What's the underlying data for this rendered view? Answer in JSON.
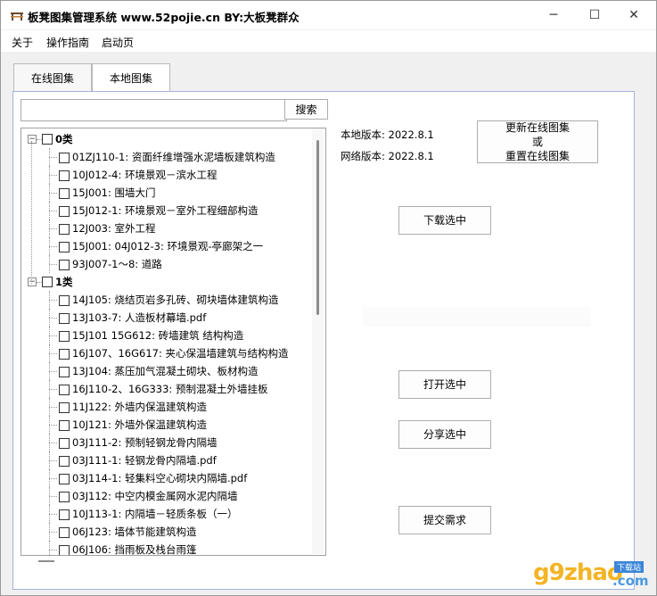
{
  "window": {
    "title": "板凳图集管理系统 www.52pojie.cn  BY:大板凳群众",
    "minimize": "─",
    "maximize": "☐",
    "close": "✕"
  },
  "menu": [
    "关于",
    "操作指南",
    "启动页"
  ],
  "tabs": [
    "在线图集",
    "本地图集"
  ],
  "search": {
    "value": "",
    "button": "搜索"
  },
  "tree": [
    {
      "label": "0类",
      "group": true
    },
    {
      "label": "01ZJ110-1: 资面纤维增强水泥墙板建筑构造"
    },
    {
      "label": "10J012-4: 环境景观－滨水工程"
    },
    {
      "label": "15J001: 围墙大门"
    },
    {
      "label": "15J012-1: 环境景观－室外工程细部构造"
    },
    {
      "label": "12J003: 室外工程"
    },
    {
      "label": "15J001: 04J012-3: 环境景观-亭廊架之一"
    },
    {
      "label": "93J007-1～8: 道路"
    },
    {
      "label": "1类",
      "group": true
    },
    {
      "label": "14J105: 烧结页岩多孔砖、砌块墙体建筑构造"
    },
    {
      "label": "13J103-7: 人造板材幕墙.pdf"
    },
    {
      "label": "15J101 15G612: 砖墙建筑 结构构造"
    },
    {
      "label": "16J107、16G617: 夹心保温墙建筑与结构构造"
    },
    {
      "label": "13J104: 蒸压加气混凝土砌块、板材构造"
    },
    {
      "label": "16J110-2、16G333: 预制混凝土外墙挂板"
    },
    {
      "label": "11J122: 外墙内保温建筑构造"
    },
    {
      "label": "10J121: 外墙外保温建筑构造"
    },
    {
      "label": "03J111-2: 预制轻钢龙骨内隔墙"
    },
    {
      "label": "03J111-1: 轻钢龙骨内隔墙.pdf"
    },
    {
      "label": "03J114-1: 轻集料空心砌块内隔墙.pdf"
    },
    {
      "label": "03J112: 中空内模金属网水泥内隔墙"
    },
    {
      "label": "10J113-1: 内隔墙－轻质条板（一）"
    },
    {
      "label": "06J123: 墙体节能建筑构造"
    },
    {
      "label": "06J106: 挡雨板及栈台雨篷"
    }
  ],
  "info": {
    "local_version": "本地版本: 2022.8.1",
    "net_version": "网络版本: 2022.8.1"
  },
  "buttons": {
    "update_line1": "更新在线图集",
    "update_line2": "或",
    "update_line3": "重置在线图集",
    "download": "下载选中",
    "open": "打开选中",
    "share": "分享选中",
    "submit": "提交需求"
  },
  "watermark": {
    "text": "g9zhao",
    "badge": "下载站",
    "domain": ".com"
  }
}
